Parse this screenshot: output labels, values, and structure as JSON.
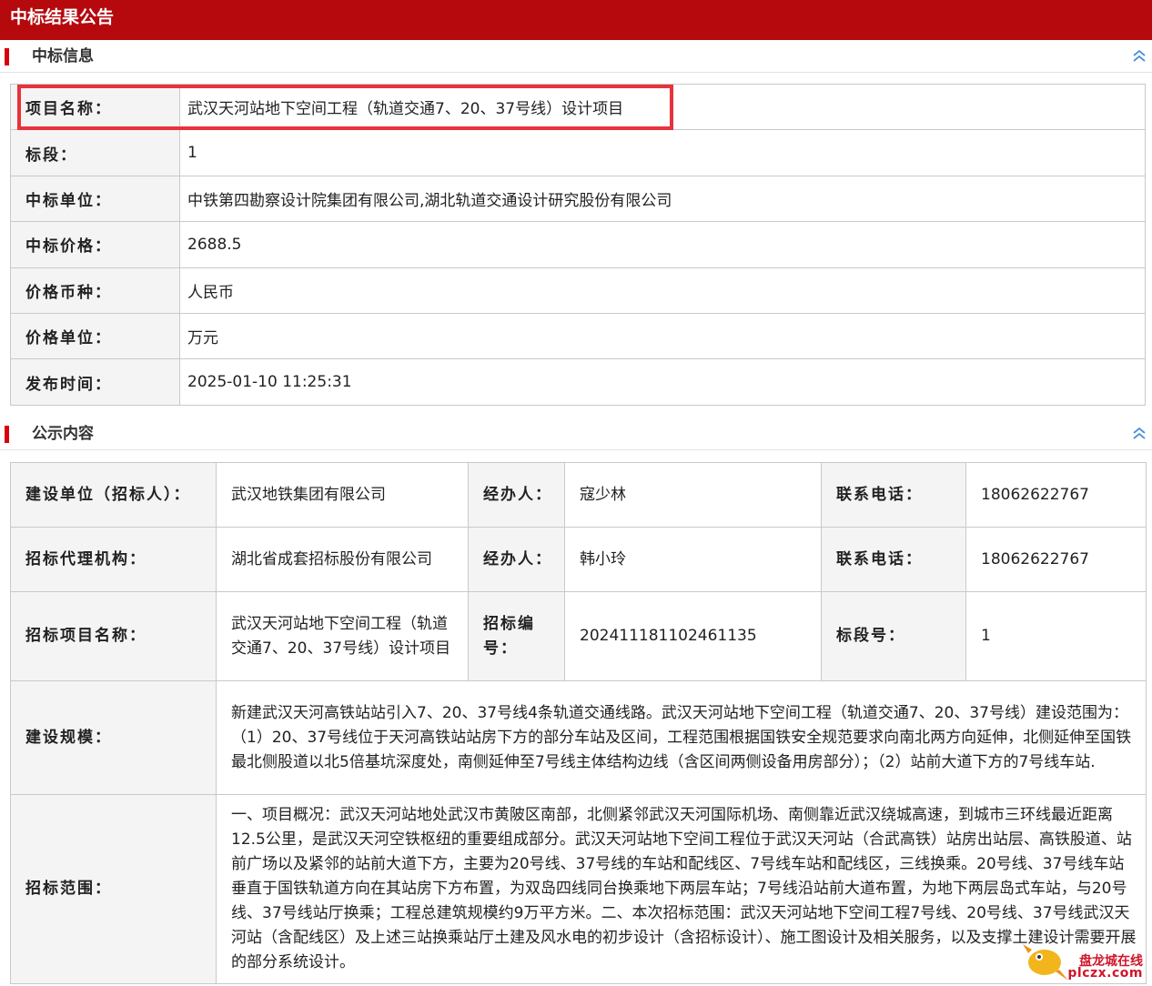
{
  "page_title": "中标结果公告",
  "section_info": {
    "label": "中标信息",
    "rows": [
      {
        "key": "项目名称：",
        "value": "武汉天河站地下空间工程（轨道交通7、20、37号线）设计项目"
      },
      {
        "key": "标段：",
        "value": "1"
      },
      {
        "key": "中标单位：",
        "value": "中铁第四勘察设计院集团有限公司,湖北轨道交通设计研究股份有限公司"
      },
      {
        "key": "中标价格：",
        "value": "2688.5"
      },
      {
        "key": "价格币种：",
        "value": "人民币"
      },
      {
        "key": "价格单位：",
        "value": "万元"
      },
      {
        "key": "发布时间：",
        "value": "2025-01-10 11:25:31"
      }
    ]
  },
  "section_notice": {
    "label": "公示内容",
    "row1": {
      "k1": "建设单位（招标人）：",
      "v1": "武汉地铁集团有限公司",
      "k2": "经办人：",
      "v2": "寇少林",
      "k3": "联系电话：",
      "v3": "18062622767"
    },
    "row2": {
      "k1": "招标代理机构：",
      "v1": "湖北省成套招标股份有限公司",
      "k2": "经办人：",
      "v2": "韩小玲",
      "k3": "联系电话：",
      "v3": "18062622767"
    },
    "row3": {
      "k1": "招标项目名称：",
      "v1": "武汉天河站地下空间工程（轨道交通7、20、37号线）设计项目",
      "k2": "招标编号：",
      "v2": "202411181102461135",
      "k3": "标段号：",
      "v3": "1"
    },
    "scale": {
      "key": "建设规模：",
      "value": "新建武汉天河高铁站站引入7、20、37号线4条轨道交通线路。武汉天河站地下空间工程（轨道交通7、20、37号线）建设范围为：（1）20、37号线位于天河高铁站站房下方的部分车站及区间，工程范围根据国铁安全规范要求向南北两方向延伸，北侧延伸至国铁最北侧股道以北5倍基坑深度处，南侧延伸至7号线主体结构边线（含区间两侧设备用房部分）；（2）站前大道下方的7号线车站."
    },
    "scope": {
      "key": "招标范围：",
      "value": "一、项目概况：武汉天河站地处武汉市黄陂区南部，北侧紧邻武汉天河国际机场、南侧靠近武汉绕城高速，到城市三环线最近距离12.5公里，是武汉天河空铁枢纽的重要组成部分。武汉天河站地下空间工程位于武汉天河站（合武高铁）站房出站层、高铁股道、站前广场以及紧邻的站前大道下方，主要为20号线、37号线的车站和配线区、7号线车站和配线区，三线换乘。20号线、37号线车站垂直于国铁轨道方向在其站房下方布置，为双岛四线同台换乘地下两层车站；7号线沿站前大道布置，为地下两层岛式车站，与20号线、37号线站厅换乘；工程总建筑规模约9万平方米。二、本次招标范围：武汉天河站地下空间工程7号线、20号线、37号线武汉天河站（含配线区）及上述三站换乘站厅土建及风水电的初步设计（含招标设计）、施工图设计及相关服务，以及支撑土建设计需要开展的部分系统设计。"
    }
  },
  "watermark": {
    "cn": "盘龙城在线",
    "url": "plczx.com"
  },
  "colors": {
    "brand_red": "#b5090e",
    "highlight": "#e8323c"
  }
}
